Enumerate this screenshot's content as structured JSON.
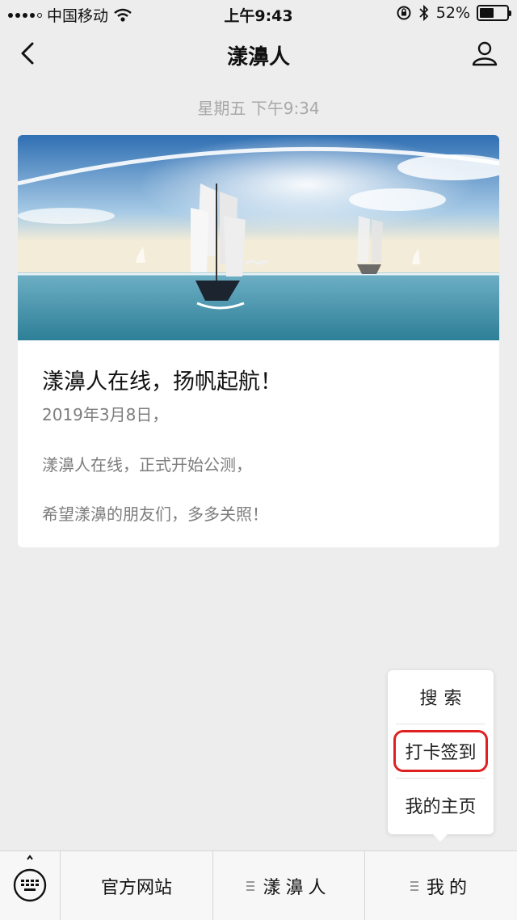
{
  "status_bar": {
    "carrier": "中国移动",
    "time": "上午9:43",
    "battery_percent": "52%",
    "battery_level": 0.52,
    "icons": [
      "signal-icon",
      "wifi-icon",
      "lock-rotation-icon",
      "bluetooth-icon",
      "battery-icon"
    ]
  },
  "nav": {
    "title": "漾濞人",
    "back_icon": "chevron-left-icon",
    "profile_icon": "user-icon"
  },
  "chat": {
    "timestamp": "星期五 下午9:34"
  },
  "article": {
    "title": "漾濞人在线，扬帆起航！",
    "date_line": "2019年3月8日，",
    "line1": "漾濞人在线，正式开始公测，",
    "line2": "希望漾濞的朋友们，多多关照！"
  },
  "popup_menu": {
    "items": [
      {
        "label": "搜索"
      },
      {
        "label": "打卡签到",
        "highlighted": true
      },
      {
        "label": "我的主页"
      }
    ],
    "highlight_color": "#e02020"
  },
  "bottom_bar": {
    "keyboard_icon": "keyboard-icon",
    "menus": [
      {
        "label": "官方网站",
        "has_submenu": false
      },
      {
        "label": "漾濞人",
        "has_submenu": true
      },
      {
        "label": "我的",
        "has_submenu": true
      }
    ]
  },
  "colors": {
    "background": "#ededed",
    "card": "#ffffff",
    "muted_text": "#7d7d7d"
  }
}
